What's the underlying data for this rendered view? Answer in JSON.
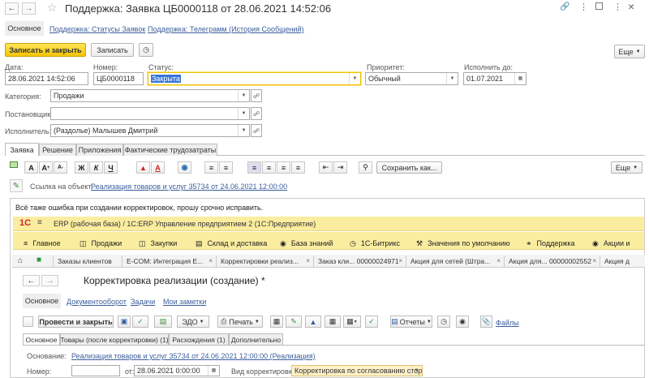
{
  "window": {
    "title": "Поддержка: Заявка ЦБ0000118 от 28.06.2021 14:52:06"
  },
  "nav_tabs": [
    {
      "label": "Основное"
    },
    {
      "label": "Поддержка: Статусы Заявок"
    },
    {
      "label": "Поддержка: Телеграмм (История Сообщений)"
    }
  ],
  "toolbar": {
    "save_close": "Записать и закрыть",
    "save": "Записать",
    "more": "Еще"
  },
  "fields": {
    "date_label": "Дата:",
    "date_value": "28.06.2021 14:52:06",
    "number_label": "Номер:",
    "number_value": "ЦБ0000118",
    "status_label": "Статус:",
    "status_value": "Закрыта",
    "priority_label": "Приоритет:",
    "priority_value": "Обычный",
    "due_label": "Исполнить до:",
    "due_value": "01.07.2021",
    "category_label": "Категория:",
    "category_value": "Продажи",
    "requester_label": "Постановщик:",
    "requester_value": "",
    "assignee_label": "Исполнитель:",
    "assignee_value": "(Раздолье) Малышев Дмитрий"
  },
  "content_tabs": [
    {
      "label": "Заявка"
    },
    {
      "label": "Решение"
    },
    {
      "label": "Приложения"
    },
    {
      "label": "Фактические трудозатраты"
    }
  ],
  "editor": {
    "save_as": "Сохранить как...",
    "more": "Еще",
    "bold": "Ж",
    "italic": "К",
    "underline": "Ч",
    "font_big": "A",
    "font_up": "A",
    "font_down": "A",
    "ref_label": "Ссылка на объект:",
    "ref_link": "Реализация товаров и услуг 35734 от 24.06.2021 12:00:00",
    "body_text": "Всё таже ошибка при создании корректировок, прошу срочно исправить."
  },
  "embedded": {
    "logo": "1С",
    "app_title": "ERP (рабочая база) / 1С:ERP Управление предприятием 2  (1С:Предприятие)",
    "menu": [
      {
        "label": "Главное"
      },
      {
        "label": "Продажи"
      },
      {
        "label": "Закупки"
      },
      {
        "label": "Склад и доставка"
      },
      {
        "label": "База знаний"
      },
      {
        "label": "1С-Битрикс"
      },
      {
        "label": "Значения по умолчанию"
      },
      {
        "label": "Поддержка"
      },
      {
        "label": "Акции и"
      }
    ],
    "open_tabs": [
      {
        "label": "Заказы клиентов"
      },
      {
        "label": "E-COM: Интеграция Е..."
      },
      {
        "label": "Корректировки реализ..."
      },
      {
        "label": "Заказ кли... 00000024971"
      },
      {
        "label": "Акция для сетей (Штра..."
      },
      {
        "label": "Акция для... 00000002552"
      },
      {
        "label": "Акция д"
      }
    ],
    "doc_title": "Корректировка реализации (создание) *",
    "doc_tabs": [
      {
        "label": "Основное"
      },
      {
        "label": "Документооборот"
      },
      {
        "label": "Задачи"
      },
      {
        "label": "Мои заметки"
      }
    ],
    "post_close": "Провести и закрыть",
    "edo": "ЭДО",
    "print": "Печать",
    "reports": "Отчеты",
    "files": "Файлы",
    "inner_tabs": [
      {
        "label": "Основное"
      },
      {
        "label": "Товары (после корректировки) (1)"
      },
      {
        "label": "Расхождения (1)"
      },
      {
        "label": "Дополнительно"
      }
    ],
    "basis_label": "Основание:",
    "basis_link": "Реализация товаров и услуг 35734 от 24.06.2021 12:00:00 (Реализация)",
    "number_label": "Номер:",
    "from_label": "от:",
    "from_value": "28.06.2021  0:00:00",
    "kind_label": "Вид корректировки:",
    "kind_value": "Корректировка по согласованию сторон"
  }
}
